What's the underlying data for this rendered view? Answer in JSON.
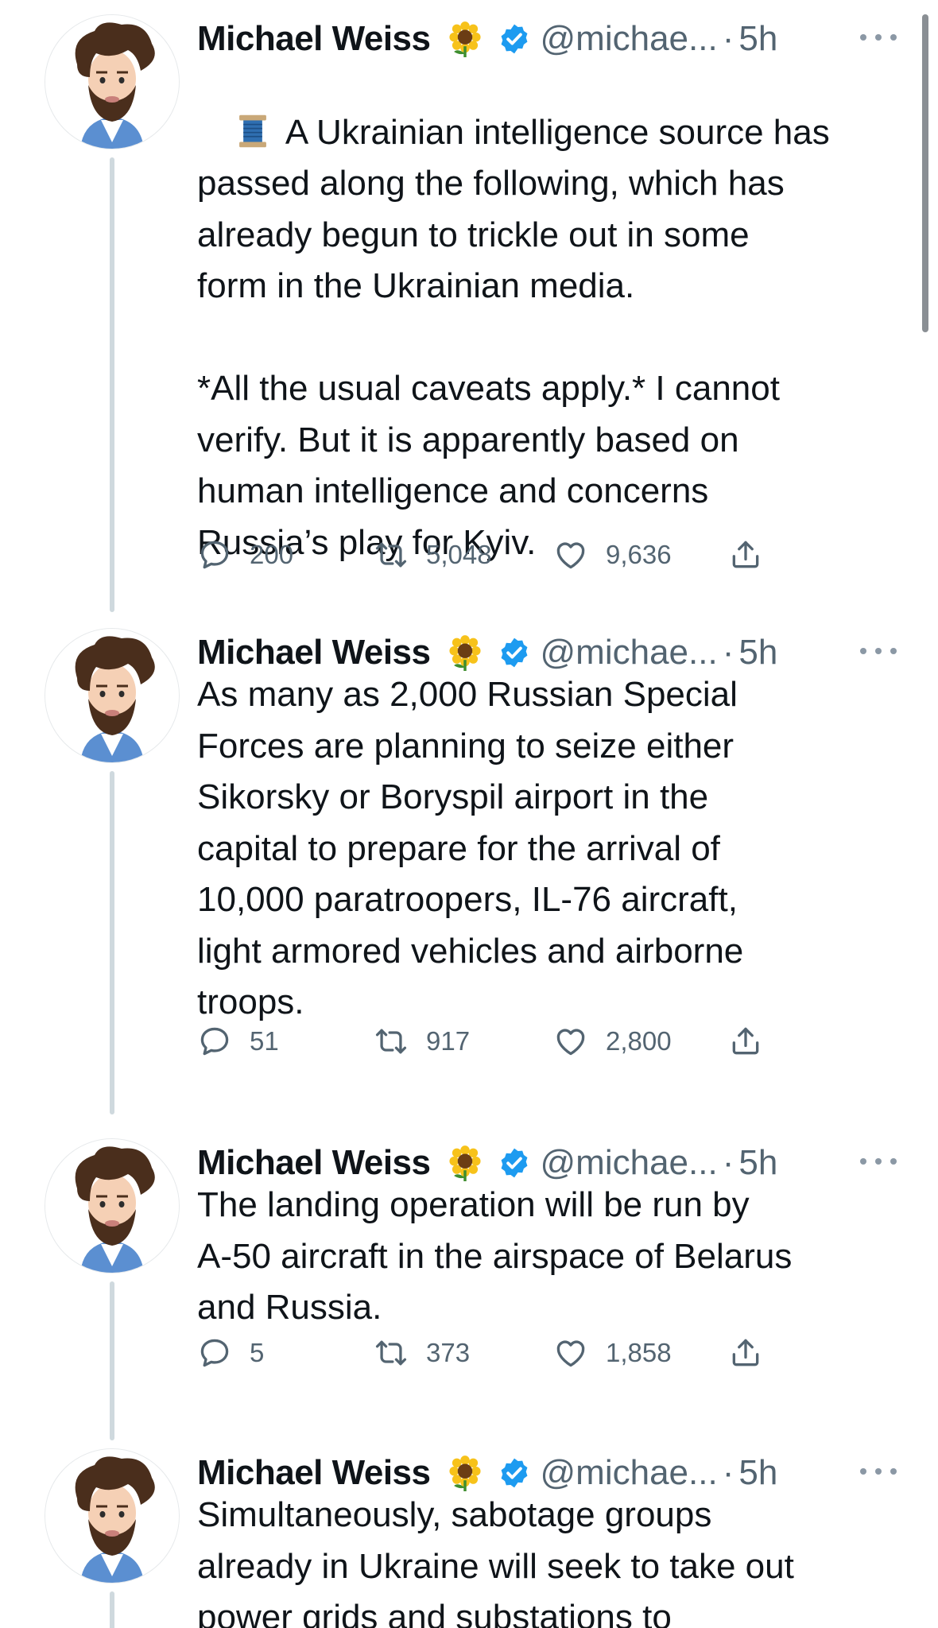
{
  "tweets": [
    {
      "name": "Michael Weiss",
      "handle": "@michae...",
      "dot": "·",
      "time": "5h",
      "text": "A Ukrainian intelligence source has\npassed along the following, which has\nalready begun to trickle out in some\nform in the Ukrainian media.\n\n*All the usual caveats apply.* I cannot\nverify. But it is apparently based on\nhuman intelligence and concerns\nRussia’s play for Kyiv.",
      "leading_icon": "thread-spool-icon",
      "replies": "200",
      "retweets": "5,048",
      "likes": "9,636"
    },
    {
      "name": "Michael Weiss",
      "handle": "@michae...",
      "dot": "·",
      "time": "5h",
      "text": "As many as 2,000 Russian Special\nForces are planning to seize either\nSikorsky or Boryspil airport in the\ncapital to prepare for the arrival of\n10,000 paratroopers, IL-76 aircraft,\nlight armored vehicles and airborne\ntroops.",
      "replies": "51",
      "retweets": "917",
      "likes": "2,800"
    },
    {
      "name": "Michael Weiss",
      "handle": "@michae...",
      "dot": "·",
      "time": "5h",
      "text": "The landing operation will be run by\nA-50 aircraft in the airspace of Belarus\nand Russia.",
      "replies": "5",
      "retweets": "373",
      "likes": "1,858"
    },
    {
      "name": "Michael Weiss",
      "handle": "@michae...",
      "dot": "·",
      "time": "5h",
      "text": "Simultaneously, sabotage groups\nalready in Ukraine will seek to take out\npower grids and substations to"
    }
  ],
  "colors": {
    "text": "#0f1419",
    "secondary": "#536471",
    "verified": "#1d9bf0",
    "thread_line": "#cfd9de"
  },
  "icons": [
    "reply-icon",
    "retweet-icon",
    "like-icon",
    "share-icon",
    "verified-badge-icon",
    "sunflower-icon",
    "more-icon"
  ]
}
